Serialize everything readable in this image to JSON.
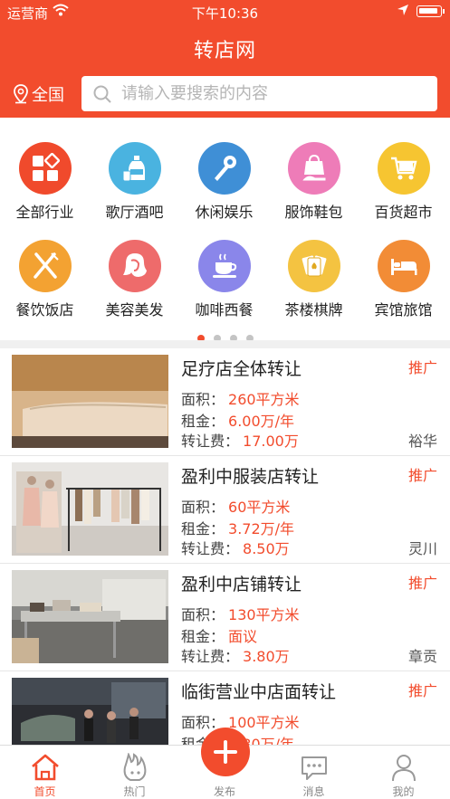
{
  "status_bar": {
    "carrier": "运营商",
    "time": "下午10:36"
  },
  "header": {
    "title": "转店网",
    "city": "全国",
    "search_placeholder": "请输入要搜索的内容"
  },
  "categories": [
    {
      "label": "全部行业",
      "icon": "grid-icon",
      "color": "#f04a2c"
    },
    {
      "label": "歌厅酒吧",
      "icon": "bottle-glass-icon",
      "color": "#4ab3e0"
    },
    {
      "label": "休闲娱乐",
      "icon": "microphone-icon",
      "color": "#3f8fd6"
    },
    {
      "label": "服饰鞋包",
      "icon": "handbag-shoe-icon",
      "color": "#ee7cb8"
    },
    {
      "label": "百货超市",
      "icon": "shopping-cart-icon",
      "color": "#f6c531"
    },
    {
      "label": "餐饮饭店",
      "icon": "fork-knife-icon",
      "color": "#f3a232"
    },
    {
      "label": "美容美发",
      "icon": "woman-hair-icon",
      "color": "#ee6b6b"
    },
    {
      "label": "咖啡西餐",
      "icon": "coffee-cup-icon",
      "color": "#8a86ea"
    },
    {
      "label": "茶楼棋牌",
      "icon": "playing-cards-icon",
      "color": "#f4c341"
    },
    {
      "label": "宾馆旅馆",
      "icon": "bed-icon",
      "color": "#f28c36"
    }
  ],
  "pager": {
    "count": 4,
    "active": 0
  },
  "listing_labels": {
    "area": "面积：",
    "rent": "租金：",
    "fee": "转让费：",
    "promo": "推广"
  },
  "listings": [
    {
      "title": "足疗店全体转让",
      "area": "260平方米",
      "rent": "6.00万/年",
      "fee": "17.00万",
      "district": "裕华",
      "image": "massage-room-photo"
    },
    {
      "title": "盈利中服装店转让",
      "area": "60平方米",
      "rent": "3.72万/年",
      "fee": "8.50万",
      "district": "灵川",
      "image": "clothing-store-photo"
    },
    {
      "title": "盈利中店铺转让",
      "area": "130平方米",
      "rent": "面议",
      "fee": "3.80万",
      "district": "章贡",
      "image": "kitchen-shop-photo"
    },
    {
      "title": "临街营业中店面转让",
      "area": "100平方米",
      "rent": "1.80万/年",
      "fee": "",
      "district": "",
      "image": "street-night-photo"
    }
  ],
  "tabbar": {
    "home": "首页",
    "hot": "热门",
    "publish": "发布",
    "messages": "消息",
    "mine": "我的"
  },
  "colors": {
    "brand": "#f24c2d"
  }
}
